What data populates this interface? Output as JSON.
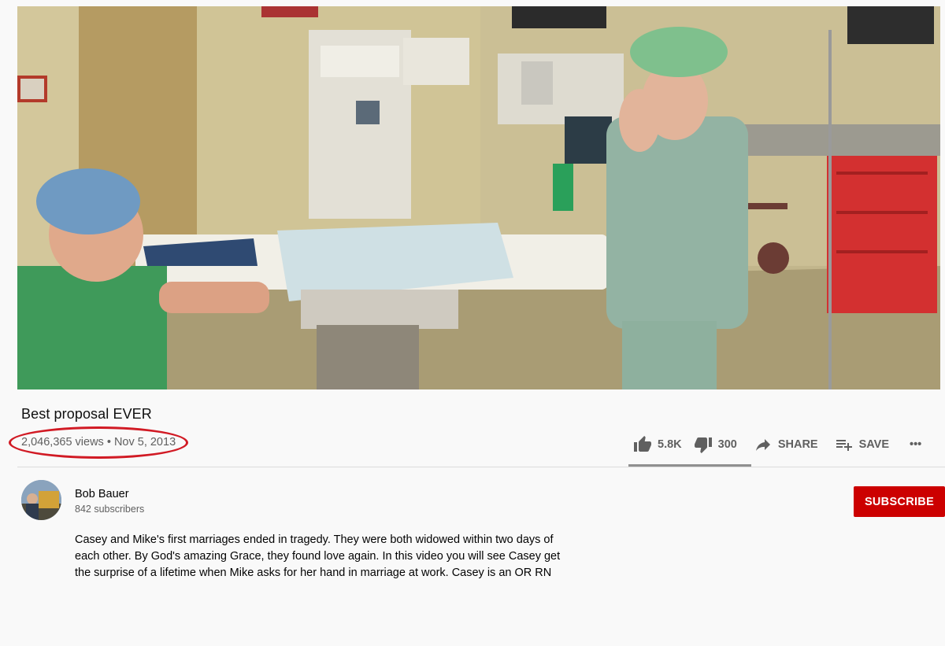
{
  "video": {
    "scene": "operating-room-proposal-still"
  },
  "title": "Best proposal EVER",
  "stats": {
    "views": "2,046,365 views",
    "separator": " • ",
    "date": "Nov 5, 2013",
    "highlight_color": "#d11a24"
  },
  "actions": {
    "likes": "5.8K",
    "dislikes": "300",
    "share_label": "SHARE",
    "save_label": "SAVE",
    "more_label": "•••",
    "like_ratio": 0.95
  },
  "channel": {
    "name": "Bob Bauer",
    "subscribers": "842 subscribers",
    "subscribe_label": "SUBSCRIBE",
    "subscribe_color": "#cc0000"
  },
  "description": [
    "Casey and Mike's first marriages ended in tragedy. They were both widowed within two days of",
    "each other. By God's amazing Grace, they found love again. In this video you will see Casey get",
    "the surprise of a lifetime when Mike asks for her hand in marriage at work. Casey is an OR RN"
  ],
  "icons": {
    "like": "thumbs-up-icon",
    "dislike": "thumbs-down-icon",
    "share": "share-arrow-icon",
    "save": "playlist-add-icon",
    "more": "more-horiz-icon"
  }
}
